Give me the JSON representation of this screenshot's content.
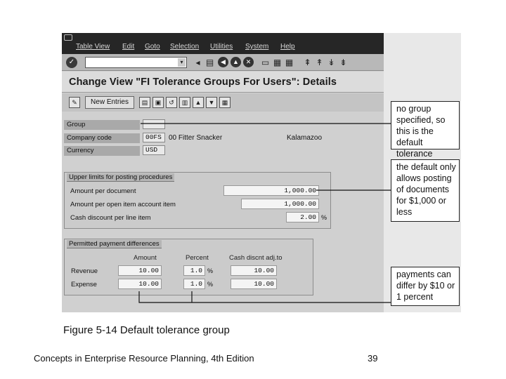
{
  "menubar": {
    "items": [
      "Table View",
      "Edit",
      "Goto",
      "Selection",
      "Utilities",
      "System",
      "Help"
    ]
  },
  "window": {
    "title": "Change View \"FI Tolerance Groups For Users\": Details"
  },
  "app_toolbar": {
    "new_entries_label": "New Entries"
  },
  "header_fields": {
    "group": {
      "label": "Group",
      "value": ""
    },
    "company_code": {
      "label": "Company code",
      "value": "00FS",
      "name": "00 Fitter Snacker",
      "city": "Kalamazoo"
    },
    "currency": {
      "label": "Currency",
      "value": "USD"
    }
  },
  "upper_limits": {
    "title": "Upper limits for posting procedures",
    "rows": [
      {
        "label": "Amount per document",
        "value": "1,000.00"
      },
      {
        "label": "Amount per open item account item",
        "value": "1,000.00"
      },
      {
        "label": "Cash discount per line item",
        "value": "2.00",
        "unit": "%"
      }
    ]
  },
  "payment_differences": {
    "title": "Permitted payment differences",
    "columns": [
      "Amount",
      "Percent",
      "Cash discnt adj.to"
    ],
    "rows": [
      {
        "label": "Revenue",
        "amount": "10.00",
        "percent": "1.0",
        "unit": "%",
        "cash": "10.00"
      },
      {
        "label": "Expense",
        "amount": "10.00",
        "percent": "1.0",
        "unit": "%",
        "cash": "10.00"
      }
    ]
  },
  "callouts": [
    "no group specified, so this is the default tolerance",
    "the default only allows posting of documents for $1,000 or less",
    "payments can differ by $10 or 1 percent"
  ],
  "caption": "Figure 5-14  Default tolerance group",
  "footer": {
    "book": "Concepts in Enterprise Resource Planning, 4th Edition",
    "page": "39"
  }
}
